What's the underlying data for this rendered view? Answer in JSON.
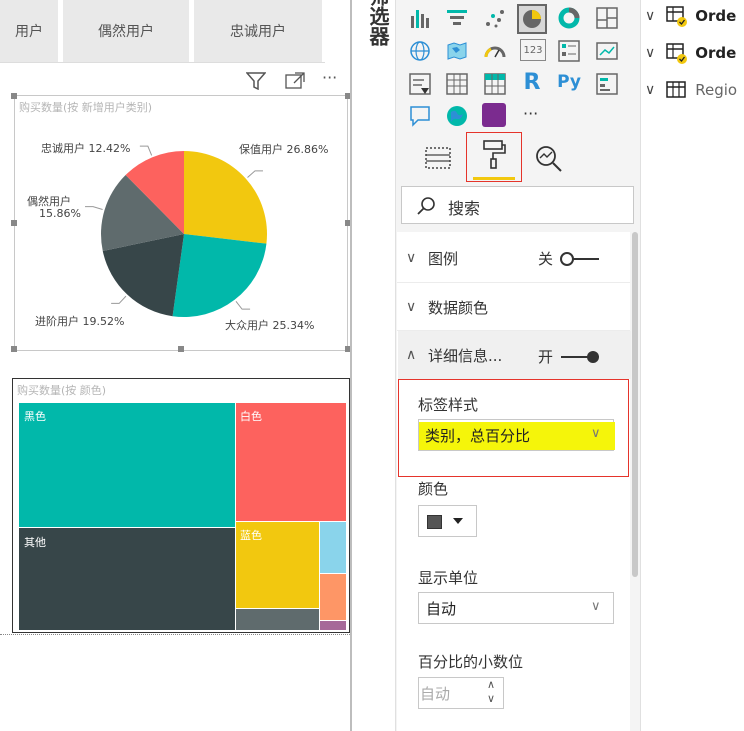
{
  "tabs": [
    "用户",
    "偶然用户",
    "忠诚用户"
  ],
  "filters_label": "筛选器",
  "pie_visual": {
    "title": "购买数量(按 新增用户类别)",
    "chart_data": {
      "type": "pie",
      "labels": [
        "保值用户",
        "大众用户",
        "进阶用户",
        "偶然用户",
        "忠诚用户"
      ],
      "values": [
        26.86,
        25.34,
        19.52,
        15.86,
        12.42
      ],
      "colors": [
        "#f2c80f",
        "#01b8aa",
        "#374649",
        "#5f6b6d",
        "#fd625e"
      ],
      "label_texts": [
        "保值用户 26.86%",
        "大众用户 25.34%",
        "进阶用户 19.52%",
        "偶然用户",
        "15.86%",
        "忠诚用户 12.42%"
      ]
    }
  },
  "treemap_visual": {
    "title": "购买数量(按 颜色)",
    "chart_data": {
      "type": "treemap",
      "labels": [
        "黑色",
        "其他",
        "白色",
        "蓝色"
      ],
      "colors": [
        "#01b8aa",
        "#374649",
        "#fd625e",
        "#f2c80f",
        "#8ad4eb",
        "#fe9666",
        "#5f6b6d",
        "#a66999"
      ]
    }
  },
  "panel": {
    "search_placeholder": "搜索",
    "sections": {
      "legend": {
        "label": "图例",
        "toggle": "关"
      },
      "data_colors": {
        "label": "数据颜色"
      },
      "details": {
        "label": "详细信息...",
        "toggle": "开"
      }
    },
    "label_style": {
      "label": "标签样式",
      "value": "类别，总百分比"
    },
    "color": {
      "label": "颜色",
      "value": "#555555"
    },
    "display_units": {
      "label": "显示单位",
      "value": "自动"
    },
    "decimal": {
      "label": "百分比的小数位",
      "value": "自动"
    }
  },
  "fields": [
    {
      "name": "Orde",
      "checked": true
    },
    {
      "name": "Orde",
      "checked": true
    },
    {
      "name": "Regio",
      "checked": false
    }
  ],
  "more_label": "···"
}
